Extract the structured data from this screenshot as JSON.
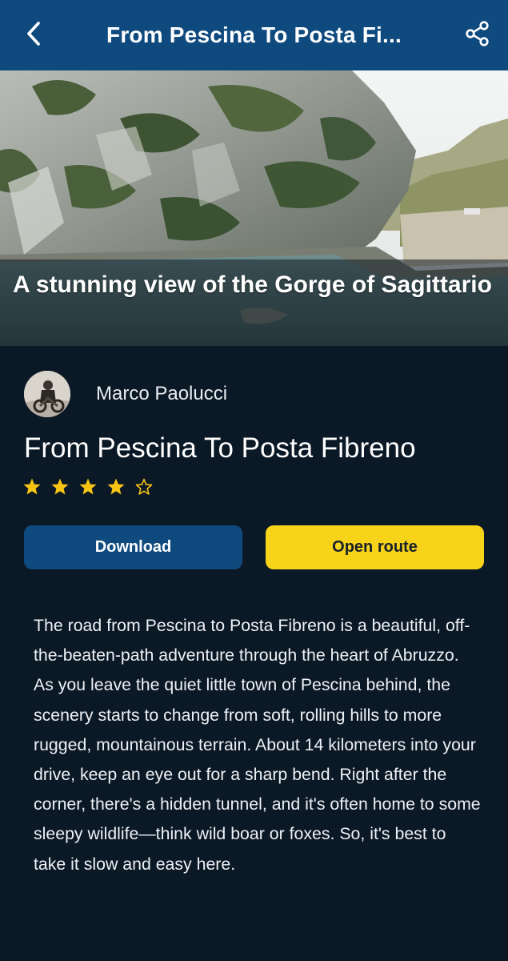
{
  "header": {
    "title": "From Pescina To Posta Fi...",
    "back_icon": "chevron-left-icon",
    "share_icon": "share-icon"
  },
  "hero": {
    "caption": "A stunning view of the Gorge of Sagittario"
  },
  "author": {
    "name": "Marco Paolucci"
  },
  "route": {
    "title": "From Pescina To Posta Fibreno",
    "rating": 4,
    "rating_max": 5
  },
  "actions": {
    "download_label": "Download",
    "open_route_label": "Open route"
  },
  "description": "The road from Pescina to Posta Fibreno is a beautiful, off-the-beaten-path adventure through the heart of Abruzzo. As you leave the quiet little town of Pescina behind, the scenery starts to change from soft, rolling hills to more rugged, mountainous terrain. About 14 kilometers into your drive, keep an eye out for a sharp bend. Right after the corner, there's a hidden tunnel, and it's often home to some sleepy wildlife—think wild boar or foxes. So, it's best to take it slow and easy here.",
  "colors": {
    "header_bg": "#0f4a7f",
    "page_bg": "#0b1826",
    "accent_yellow": "#f7d31a",
    "star_color": "#f7c512"
  }
}
